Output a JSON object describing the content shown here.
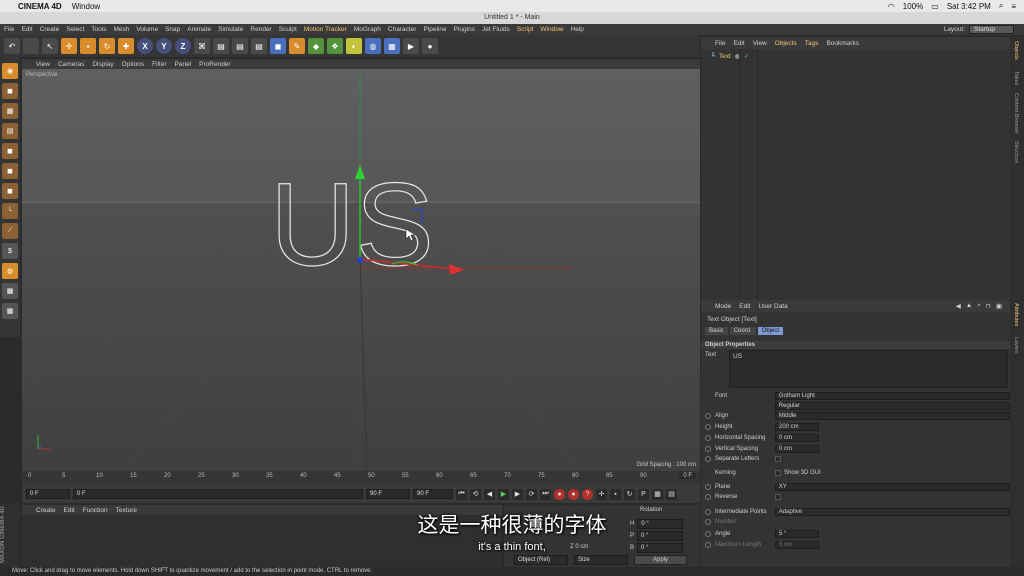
{
  "macbar": {
    "app": "CINEMA 4D",
    "menu": "Window",
    "battery": "100%",
    "clock": "Sat 3:42 PM"
  },
  "window_title": "Untitled 1 * - Main",
  "menubar": {
    "items": [
      "File",
      "Edit",
      "Create",
      "Select",
      "Tools",
      "Mesh",
      "Volume",
      "Snap",
      "Animate",
      "Simulate",
      "Render",
      "Sculpt",
      "Motion Tracker",
      "MoGraph",
      "Character",
      "Pipeline",
      "Plugins",
      "Jet Fluids",
      "Script",
      "Window",
      "Help"
    ],
    "layout_label": "Layout:",
    "layout_value": "Startup"
  },
  "toolbar": {
    "axis_x": "X",
    "axis_y": "Y",
    "axis_z": "Z"
  },
  "viewport": {
    "menu": [
      "View",
      "Cameras",
      "Display",
      "Options",
      "Filter",
      "Panel",
      "ProRender"
    ],
    "label": "Perspective",
    "grid_spacing": "Grid Spacing : 100 cm",
    "text_object": "US"
  },
  "timeline": {
    "ticks": [
      "0",
      "5",
      "10",
      "15",
      "20",
      "25",
      "30",
      "35",
      "40",
      "45",
      "50",
      "55",
      "60",
      "65",
      "70",
      "75",
      "80",
      "85",
      "90"
    ],
    "end_label": "0 F",
    "start_field": "0 F",
    "current_field": "0 F",
    "end_field1": "90 F",
    "end_field2": "90 F"
  },
  "materials_menu": [
    "Create",
    "Edit",
    "Function",
    "Texture"
  ],
  "maxon_logo": "MAXON CINEMA 4D",
  "coords": {
    "header": "Rotation",
    "rows": [
      {
        "axis": "H",
        "value": "0 °"
      },
      {
        "axis": "P",
        "value": "0 °"
      },
      {
        "axis": "B",
        "value": "0 °"
      }
    ],
    "partial_left1": "2 c",
    "partial_left2": "Z  0 cm",
    "mode1": "Object (Rel)",
    "mode2": "Size",
    "apply": "Apply"
  },
  "status_text": "Move: Click and drag to move elements. Hold down SHIFT to quantize movement / add to the selection in point mode, CTRL to remove.",
  "objects_menu": [
    "File",
    "Edit",
    "View",
    "Objects",
    "Tags",
    "Bookmarks"
  ],
  "object_item": "Text",
  "attributes_menu": [
    "Mode",
    "Edit",
    "User Data"
  ],
  "attributes": {
    "object_title": "Text Object [Text]",
    "tabs": [
      "Basic",
      "Coord.",
      "Object"
    ],
    "section": "Object Properties",
    "text_label": "Text",
    "text_value": "US",
    "font_label": "Font",
    "font_value": "Gotham Light",
    "font_style": "Regular",
    "align_label": "Align",
    "align_value": "Middle",
    "height_label": "Height",
    "height_value": "200 cm",
    "hspacing_label": "Horizontal Spacing",
    "hspacing_value": "0 cm",
    "vspacing_label": "Vertical Spacing",
    "vspacing_value": "0 cm",
    "separate_label": "Separate Letters",
    "kerning_label": "Kerning",
    "show3d_label": "Show 3D GUI",
    "plane_label": "Plane",
    "plane_value": "XY",
    "reverse_label": "Reverse",
    "ipoints_label": "Intermediate Points",
    "ipoints_value": "Adaptive",
    "number_label": "Number",
    "angle_label": "Angle",
    "angle_value": "5 °",
    "maxlength_label": "Maximum Length",
    "maxlength_value": "5 cm"
  },
  "right_tabs": [
    "Objects",
    "Takes",
    "Content Browser",
    "Structure",
    "Attributes",
    "Layers"
  ],
  "subtitle_cn": "这是一种很薄的字体",
  "subtitle_en": "it's a thin font,"
}
